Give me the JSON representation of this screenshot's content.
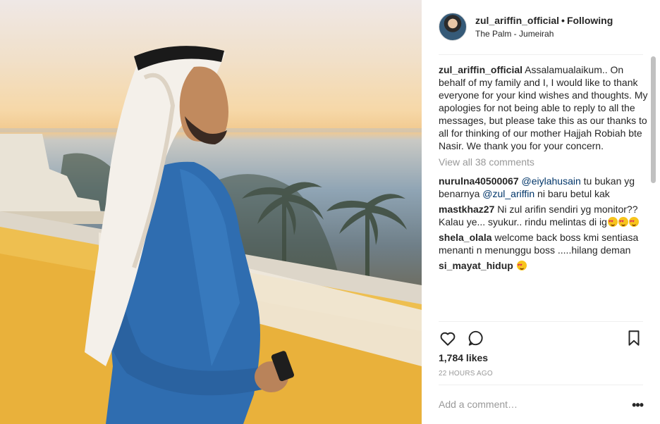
{
  "post": {
    "username": "zul_ariffin_official",
    "separator": "•",
    "follow_label": "Following",
    "location": "The Palm - Jumeirah",
    "caption_user": "zul_ariffin_official",
    "caption_text": "Assalamualaikum.. On behalf of my family and I, I would like to thank everyone for your kind wishes and thoughts. My apologies for not being able to reply to all the messages, but please take this as our thanks to all for thinking of our mother Hajjah Robiah bte Nasir. We thank you for your concern.",
    "view_all_comments": "View all 38 comments",
    "comments": [
      {
        "user": "nurulna40500067",
        "mention1": "@eiylahusain",
        "text1": " tu bukan yg benarnya ",
        "mention2": "@zul_ariffin",
        "text2": " ni baru betul kak"
      },
      {
        "user": "mastkhaz27",
        "text": "Ni zul arifin sendiri yg monitor?? Kalau ye... syukur.. rindu melintas di ig",
        "emoji": "heart-eyes-emoji-x3"
      },
      {
        "user": "shela_olala",
        "text": "welcome back boss kmi sentiasa menanti n menunggu boss .....hilang deman"
      },
      {
        "user": "si_mayat_hidup",
        "text": "",
        "emoji": "heart-eyes-emoji"
      }
    ],
    "likes": "1,784 likes",
    "time_ago": "22 HOURS AGO",
    "add_comment_placeholder": "Add a comment…",
    "more_options": "•••"
  },
  "icons": [
    "heart-icon",
    "comment-icon",
    "bookmark-icon",
    "more-options-icon",
    "avatar"
  ],
  "colors": {
    "text": "#262626",
    "muted": "#999999",
    "link": "#003569",
    "border": "#efefef"
  }
}
